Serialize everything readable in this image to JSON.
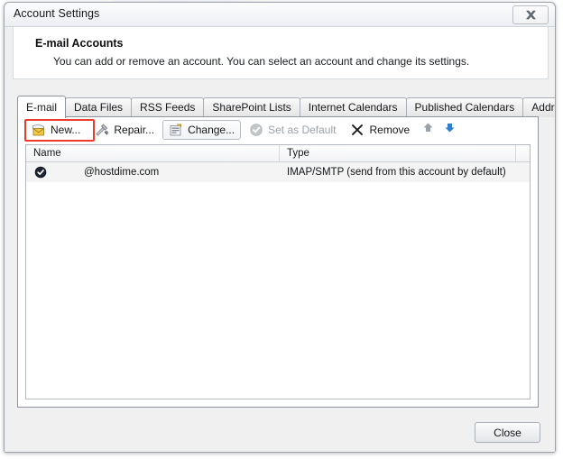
{
  "window": {
    "title": "Account Settings",
    "close_icon": "close-x-icon"
  },
  "header": {
    "title": "E-mail Accounts",
    "description": "You can add or remove an account. You can select an account and change its settings."
  },
  "tabs": [
    {
      "label": "E-mail",
      "selected": true
    },
    {
      "label": "Data Files",
      "selected": false
    },
    {
      "label": "RSS Feeds",
      "selected": false
    },
    {
      "label": "SharePoint Lists",
      "selected": false
    },
    {
      "label": "Internet Calendars",
      "selected": false
    },
    {
      "label": "Published Calendars",
      "selected": false
    },
    {
      "label": "Address Books",
      "selected": false
    }
  ],
  "toolbar": {
    "new_label": "New...",
    "repair_label": "Repair...",
    "change_label": "Change...",
    "set_default_label": "Set as Default",
    "remove_label": "Remove",
    "move_up_icon": "arrow-up-icon",
    "move_down_icon": "arrow-down-icon"
  },
  "annotation": {
    "highlight_color": "#ef3b2b",
    "highlight_target": "new-button"
  },
  "list": {
    "columns": [
      "Name",
      "Type"
    ],
    "rows": [
      {
        "icon": "account-check-icon",
        "name": "@hostdime.com",
        "type": "IMAP/SMTP (send from this account by default)"
      }
    ]
  },
  "footer": {
    "close_label": "Close"
  }
}
